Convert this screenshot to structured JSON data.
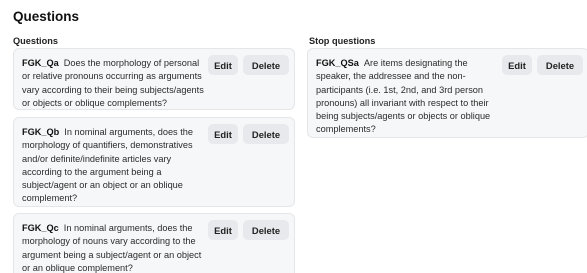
{
  "page": {
    "title": "Questions"
  },
  "columns": {
    "questions": {
      "heading": "Questions",
      "items": [
        {
          "id": "FGK_Qa",
          "text": "Does the morphology of personal or relative pronouns occurring as arguments vary according to their being subjects/agents or objects or oblique complements?",
          "edit_label": "Edit",
          "delete_label": "Delete"
        },
        {
          "id": "FGK_Qb",
          "text": "In nominal arguments, does the morphology of quantifiers, demonstratives and/or definite/indefinite articles vary according to the argument being a subject/agent or an object or an oblique complement?",
          "edit_label": "Edit",
          "delete_label": "Delete"
        },
        {
          "id": "FGK_Qc",
          "text": "In nominal arguments, does the morphology of nouns vary according to the argument being a subject/agent or an object or an oblique complement?",
          "edit_label": "Edit",
          "delete_label": "Delete"
        }
      ]
    },
    "stop_questions": {
      "heading": "Stop questions",
      "items": [
        {
          "id": "FGK_QSa",
          "text": "Are items designating the speaker, the addressee and the non-participants (i.e. 1st, 2nd, and 3rd person pronouns) all invariant with respect to their being subjects/agents or objects or oblique complements?",
          "edit_label": "Edit",
          "delete_label": "Delete"
        }
      ]
    }
  }
}
